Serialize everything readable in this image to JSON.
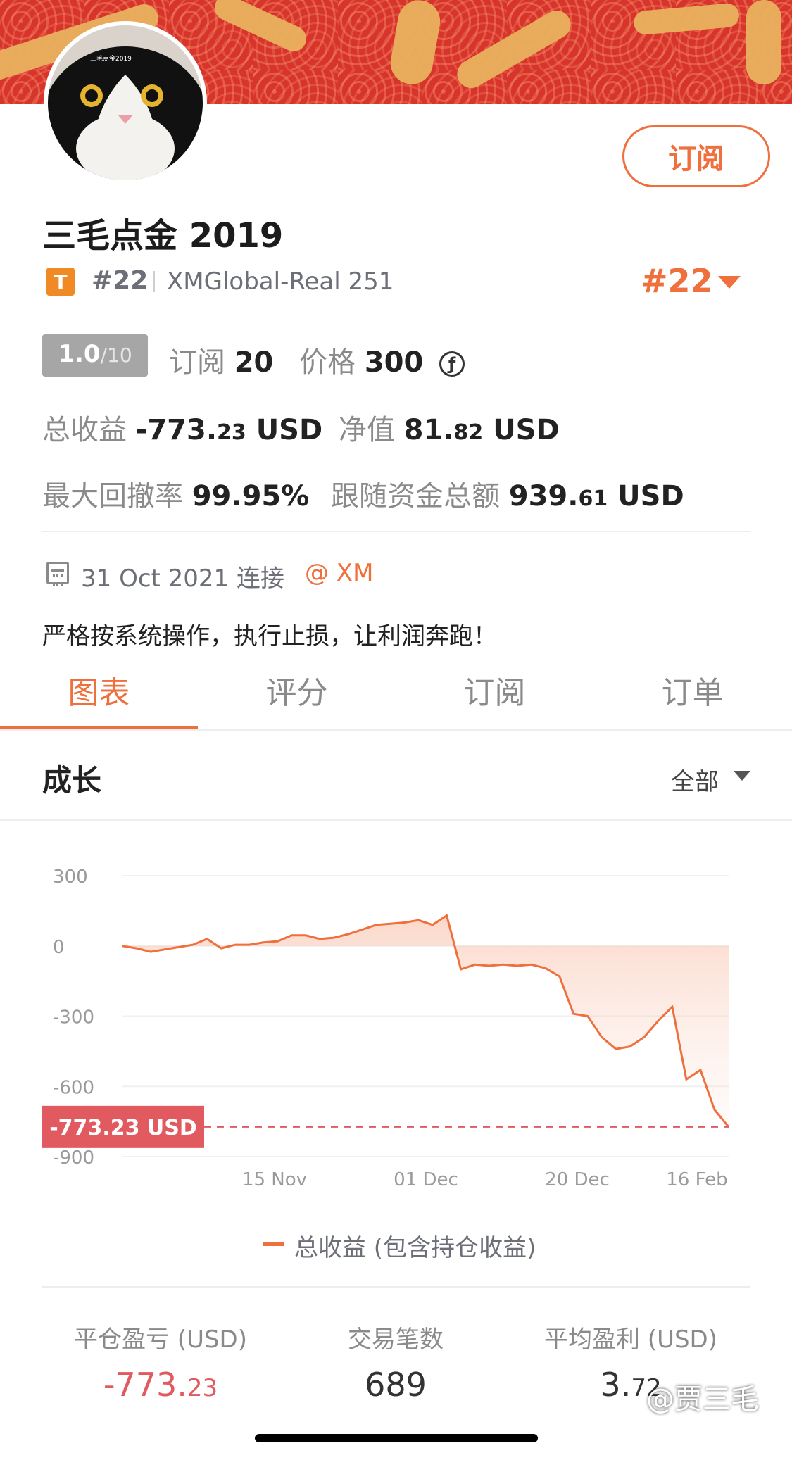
{
  "header": {
    "subscribe_label": "订阅",
    "title": "三毛点金 2019",
    "badge_letter": "T",
    "rank_small": "#22",
    "server": "XMGlobal-Real 251",
    "rank_big": "#22",
    "avatar_caption": "三毛点金2019"
  },
  "stats_line1": {
    "score_main": "1.0",
    "score_sub": "/10",
    "subs_label": "订阅",
    "subs_value": "20",
    "price_label": "价格",
    "price_value": "300",
    "coin_icon": "f-coin-icon"
  },
  "stats_line2": {
    "total_label": "总收益",
    "total_int": "-773.",
    "total_dec": "23",
    "total_unit": "USD",
    "equity_label": "净值",
    "equity_int": "81.",
    "equity_dec": "82",
    "equity_unit": "USD"
  },
  "stats_line3": {
    "drawdown_label": "最大回撤率",
    "drawdown_value": "99.95%",
    "follow_label": "跟随资金总额",
    "follow_int": "939.",
    "follow_dec": "61",
    "follow_unit": "USD"
  },
  "connect": {
    "date_text": "31 Oct 2021 连接",
    "broker": "@ XM"
  },
  "slogan": "严格按系统操作，执行止损，让利润奔跑！",
  "tabs": [
    {
      "label": "图表",
      "active": true
    },
    {
      "label": "评分",
      "active": false
    },
    {
      "label": "订阅",
      "active": false
    },
    {
      "label": "订单",
      "active": false
    }
  ],
  "section": {
    "title": "成长",
    "range": "全部"
  },
  "chart_data": {
    "type": "area",
    "yticks": [
      "300",
      "0",
      "-300",
      "-600",
      "-900"
    ],
    "ylim": [
      -900,
      300
    ],
    "xticks": [
      "15 Nov",
      "01 Dec",
      "20 Dec",
      "16 Feb"
    ],
    "current_label": "-773.23 USD",
    "current_value": -773.23,
    "legend": "总收益 (包含持仓收益)",
    "series": [
      {
        "name": "总收益 (包含持仓收益)",
        "values": [
          0,
          -10,
          -25,
          -15,
          -5,
          5,
          30,
          -10,
          5,
          5,
          15,
          20,
          45,
          45,
          30,
          35,
          50,
          70,
          90,
          95,
          100,
          110,
          90,
          130,
          -100,
          -80,
          -85,
          -80,
          -85,
          -80,
          -95,
          -130,
          -290,
          -300,
          -390,
          -440,
          -430,
          -390,
          -320,
          -260,
          -570,
          -530,
          -700,
          -773.23
        ]
      }
    ],
    "colors": {
      "line": "#ef6f3d",
      "marker": "#e05a5f"
    }
  },
  "summary": [
    {
      "label": "平仓盈亏 (USD)",
      "value_int": "-773.",
      "value_dec": "23",
      "color": "#e05a5f"
    },
    {
      "label": "交易笔数",
      "value_int": "689",
      "value_dec": "",
      "color": "#333333"
    },
    {
      "label": "平均盈利 (USD)",
      "value_int": "3.",
      "value_dec": "72",
      "color": "#333333"
    }
  ],
  "watermark": "@贾三毛"
}
